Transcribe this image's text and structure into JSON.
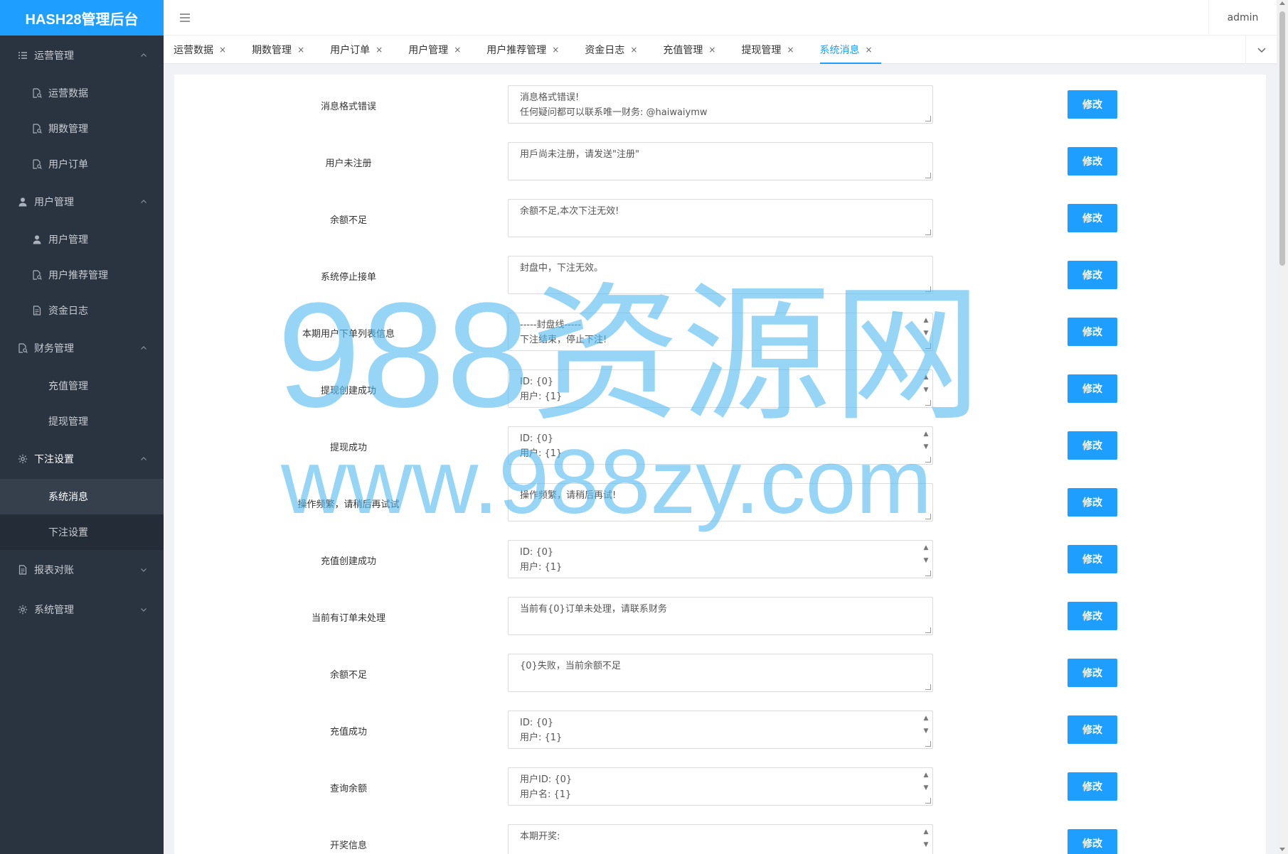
{
  "app": {
    "title": "HASH28管理后台",
    "user": "admin"
  },
  "sidebar": {
    "groups": [
      {
        "label": "运营管理",
        "icon": "list-icon",
        "expanded": true,
        "items": [
          {
            "label": "运营数据",
            "icon": "doc-search-icon"
          },
          {
            "label": "期数管理",
            "icon": "doc-search-icon"
          },
          {
            "label": "用户订单",
            "icon": "doc-search-icon"
          }
        ]
      },
      {
        "label": "用户管理",
        "icon": "user-icon",
        "expanded": true,
        "items": [
          {
            "label": "用户管理",
            "icon": "user-icon"
          },
          {
            "label": "用户推荐管理",
            "icon": "doc-search-icon"
          },
          {
            "label": "资金日志",
            "icon": "doc-icon"
          }
        ]
      },
      {
        "label": "财务管理",
        "icon": "doc-search-icon",
        "expanded": true,
        "items": [
          {
            "label": "充值管理"
          },
          {
            "label": "提现管理"
          }
        ]
      },
      {
        "label": "下注设置",
        "icon": "gear-icon",
        "expanded": true,
        "active": true,
        "items": [
          {
            "label": "系统消息",
            "selected": true
          },
          {
            "label": "下注设置"
          }
        ]
      },
      {
        "label": "报表对账",
        "icon": "doc-icon",
        "expanded": false
      },
      {
        "label": "系统管理",
        "icon": "gear-icon",
        "expanded": false
      }
    ]
  },
  "tabs": [
    {
      "label": "运营数据"
    },
    {
      "label": "期数管理"
    },
    {
      "label": "用户订单"
    },
    {
      "label": "用户管理"
    },
    {
      "label": "用户推荐管理"
    },
    {
      "label": "资金日志"
    },
    {
      "label": "充值管理"
    },
    {
      "label": "提现管理"
    },
    {
      "label": "系统消息",
      "active": true
    }
  ],
  "close_glyph": "×",
  "edit_label": "修改",
  "messages": [
    {
      "label": "消息格式错误",
      "lines": [
        "消息格式错误!",
        "任何疑问都可以联系唯一财务: @haiwaiymw"
      ],
      "scroll": false
    },
    {
      "label": "用户未注册",
      "lines": [
        "用戶尚未注册，请发送\"注册\""
      ],
      "scroll": false
    },
    {
      "label": "余额不足",
      "lines": [
        "余额不足,本次下注无效!"
      ],
      "scroll": false
    },
    {
      "label": "系统停止接单",
      "lines": [
        "封盘中，下注无效。"
      ],
      "scroll": false
    },
    {
      "label": "本期用户下单列表信息",
      "lines": [
        "-----封盘线-----",
        "下注结束，停止下注!"
      ],
      "scroll": true
    },
    {
      "label": "提现创建成功",
      "lines": [
        "ID: {0}",
        "用户: {1}"
      ],
      "scroll": true
    },
    {
      "label": "提现成功",
      "lines": [
        "ID: {0}",
        "用户: {1}"
      ],
      "scroll": true
    },
    {
      "label": "操作频繁，请稍后再试试",
      "lines": [
        "操作频繁，请稍后再试!"
      ],
      "scroll": false
    },
    {
      "label": "充值创建成功",
      "lines": [
        "ID: {0}",
        "用户: {1}"
      ],
      "scroll": true
    },
    {
      "label": "当前有订单未处理",
      "lines": [
        "当前有{0}订单未处理，请联系财务"
      ],
      "scroll": false
    },
    {
      "label": "余额不足",
      "lines": [
        "{0}失败，当前余额不足"
      ],
      "scroll": false
    },
    {
      "label": "充值成功",
      "lines": [
        "ID: {0}",
        "用户: {1}"
      ],
      "scroll": true
    },
    {
      "label": "查询余额",
      "lines": [
        "用户ID: {0}",
        "用户名: {1}"
      ],
      "scroll": true
    },
    {
      "label": "开奖信息",
      "lines": [
        "本期开奖:"
      ],
      "scroll": true
    }
  ],
  "watermark": {
    "line1": "988资源网",
    "line2": "www.988zy.com"
  },
  "colors": {
    "accent": "#1e9fff",
    "sidebar_bg": "#2a3441"
  }
}
